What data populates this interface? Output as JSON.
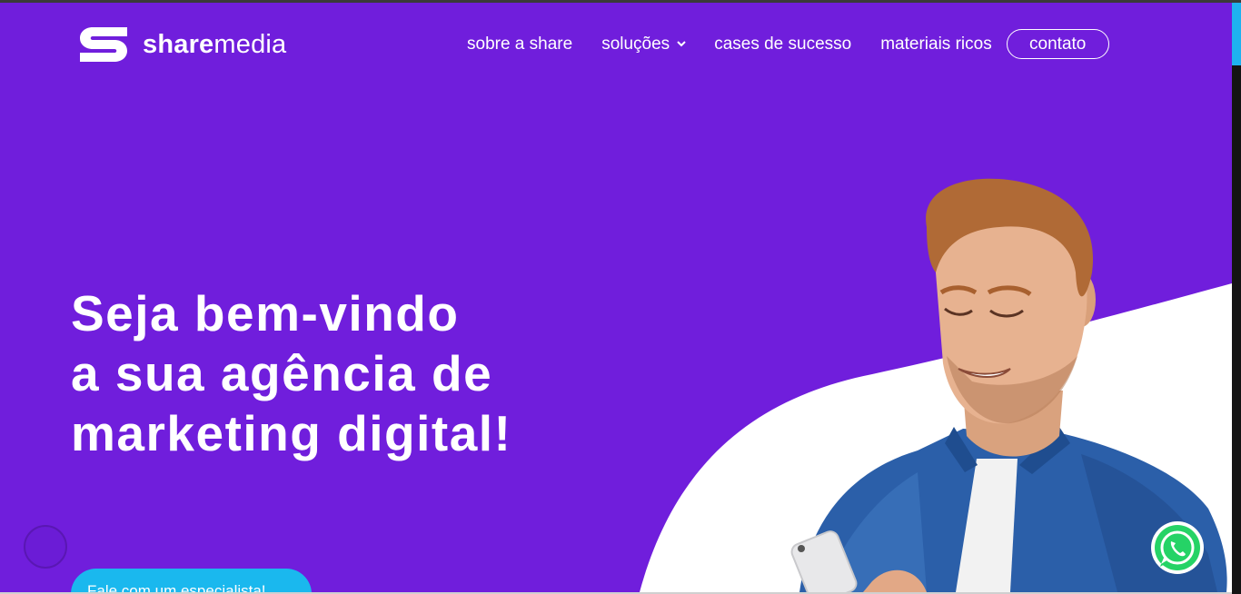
{
  "brand": {
    "name_bold": "share",
    "name_light": "media"
  },
  "nav": {
    "items": [
      {
        "label": "sobre a share"
      },
      {
        "label": "soluções"
      },
      {
        "label": "cases de sucesso"
      },
      {
        "label": "materiais ricos"
      }
    ],
    "contact_label": "contato"
  },
  "hero": {
    "title_lines": [
      "Seja bem-vindo",
      "a sua agência de",
      "marketing digital!"
    ],
    "cta_label": "Fale com um especialista!"
  },
  "icons": {
    "dropdown": "chevron-down-icon",
    "whatsapp": "whatsapp-icon",
    "logo": "sharemedia-logo-icon"
  },
  "colors": {
    "background": "#701edc",
    "cta": "#1ab8ee",
    "whatsapp": "#25d366",
    "scroll_thumb": "#1fb2f0"
  }
}
